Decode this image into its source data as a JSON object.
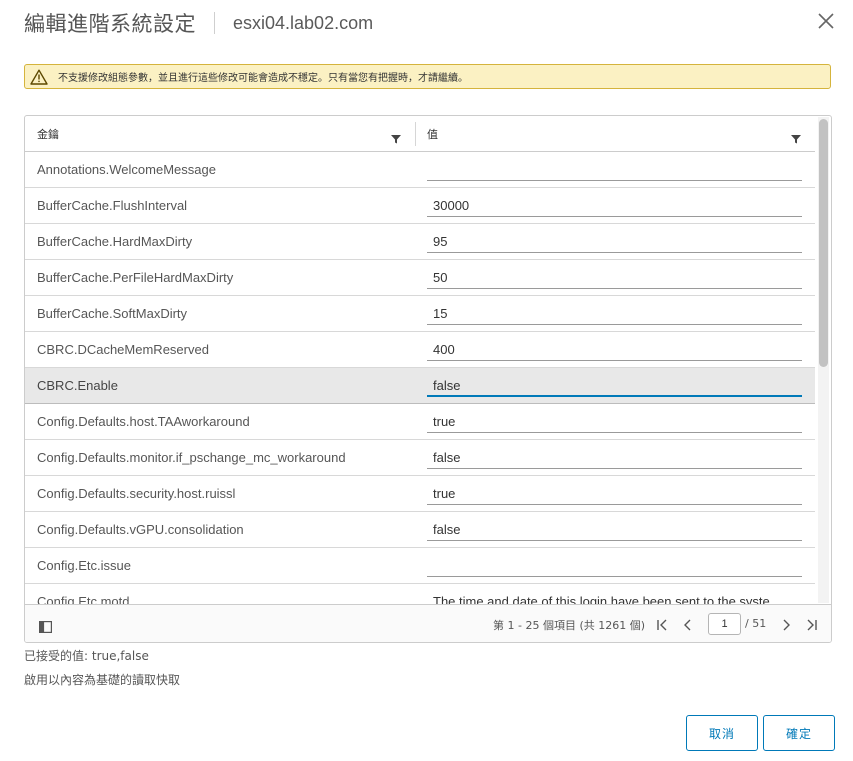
{
  "dialog": {
    "title": "編輯進階系統設定",
    "host": "esxi04.lab02.com"
  },
  "warning": {
    "text": "不支援修改組態參數，並且進行這些修改可能會造成不穩定。只有當您有把握時，才請繼續。"
  },
  "grid": {
    "columns": {
      "key": "金鑰",
      "value": "值"
    },
    "rows": [
      {
        "key": "Annotations.WelcomeMessage",
        "value": ""
      },
      {
        "key": "BufferCache.FlushInterval",
        "value": "30000"
      },
      {
        "key": "BufferCache.HardMaxDirty",
        "value": "95"
      },
      {
        "key": "BufferCache.PerFileHardMaxDirty",
        "value": "50"
      },
      {
        "key": "BufferCache.SoftMaxDirty",
        "value": "15"
      },
      {
        "key": "CBRC.DCacheMemReserved",
        "value": "400"
      },
      {
        "key": "CBRC.Enable",
        "value": "false"
      },
      {
        "key": "Config.Defaults.host.TAAworkaround",
        "value": "true"
      },
      {
        "key": "Config.Defaults.monitor.if_pschange_mc_workaround",
        "value": "false"
      },
      {
        "key": "Config.Defaults.security.host.ruissl",
        "value": "true"
      },
      {
        "key": "Config.Defaults.vGPU.consolidation",
        "value": "false"
      },
      {
        "key": "Config.Etc.issue",
        "value": ""
      },
      {
        "key": "Config.Etc.motd",
        "value": "The time and date of this login have been sent to the syste"
      }
    ],
    "selected_row": 6
  },
  "pagination": {
    "summary": "第 1 - 25 個項目 (共 1261 個)",
    "current_page": "1",
    "total": "/ 51"
  },
  "info": {
    "accepted": "已接受的值: true,false",
    "description": "啟用以內容為基礎的讀取快取"
  },
  "buttons": {
    "cancel": "取消",
    "ok": "確定"
  },
  "colors": {
    "accent": "#0079b8",
    "warning_bg": "#fbf1c3",
    "warning_border": "#d5b43c"
  }
}
